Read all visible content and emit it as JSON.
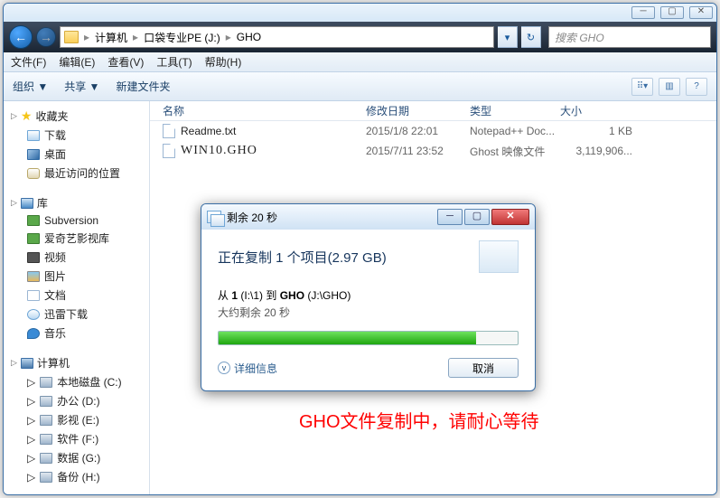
{
  "breadcrumb": {
    "root": "计算机",
    "drive": "口袋专业PE (J:)",
    "folder": "GHO"
  },
  "search": {
    "placeholder": "搜索 GHO"
  },
  "menu": {
    "file": "文件(F)",
    "edit": "编辑(E)",
    "view": "查看(V)",
    "tools": "工具(T)",
    "help": "帮助(H)"
  },
  "toolbar": {
    "organize": "组织 ▼",
    "share": "共享 ▼",
    "newfolder": "新建文件夹"
  },
  "sidebar": {
    "fav": "收藏夹",
    "downloads": "下载",
    "desktop": "桌面",
    "recent": "最近访问的位置",
    "lib": "库",
    "subversion": "Subversion",
    "iqiyi": "爱奇艺影视库",
    "video": "视频",
    "pictures": "图片",
    "documents": "文档",
    "xunlei": "迅雷下载",
    "music": "音乐",
    "computer": "计算机",
    "cdrive": "本地磁盘 (C:)",
    "ddrive": "办公 (D:)",
    "edrive": "影视 (E:)",
    "fdrive": "软件 (F:)",
    "gdrive": "数据 (G:)",
    "hdrive": "备份 (H:)"
  },
  "columns": {
    "name": "名称",
    "date": "修改日期",
    "type": "类型",
    "size": "大小"
  },
  "files": [
    {
      "name": "Readme.txt",
      "date": "2015/1/8 22:01",
      "type": "Notepad++ Doc...",
      "size": "1 KB"
    },
    {
      "name": "WIN10.GHO",
      "date": "2015/7/11 23:52",
      "type": "Ghost 映像文件",
      "size": "3,119,906..."
    }
  ],
  "dialog": {
    "title": "剩余 20 秒",
    "heading": "正在复制 1 个项目(2.97 GB)",
    "from_prefix": "从 ",
    "from_b1": "1",
    "from_mid1": " (I:\\1) ",
    "to_word": "到 ",
    "to_b": "GHO",
    "to_suffix": " (J:\\GHO)",
    "eta": "大约剩余 20 秒",
    "more": "详细信息",
    "cancel": "取消"
  },
  "annotation": "GHO文件复制中，请耐心等待"
}
